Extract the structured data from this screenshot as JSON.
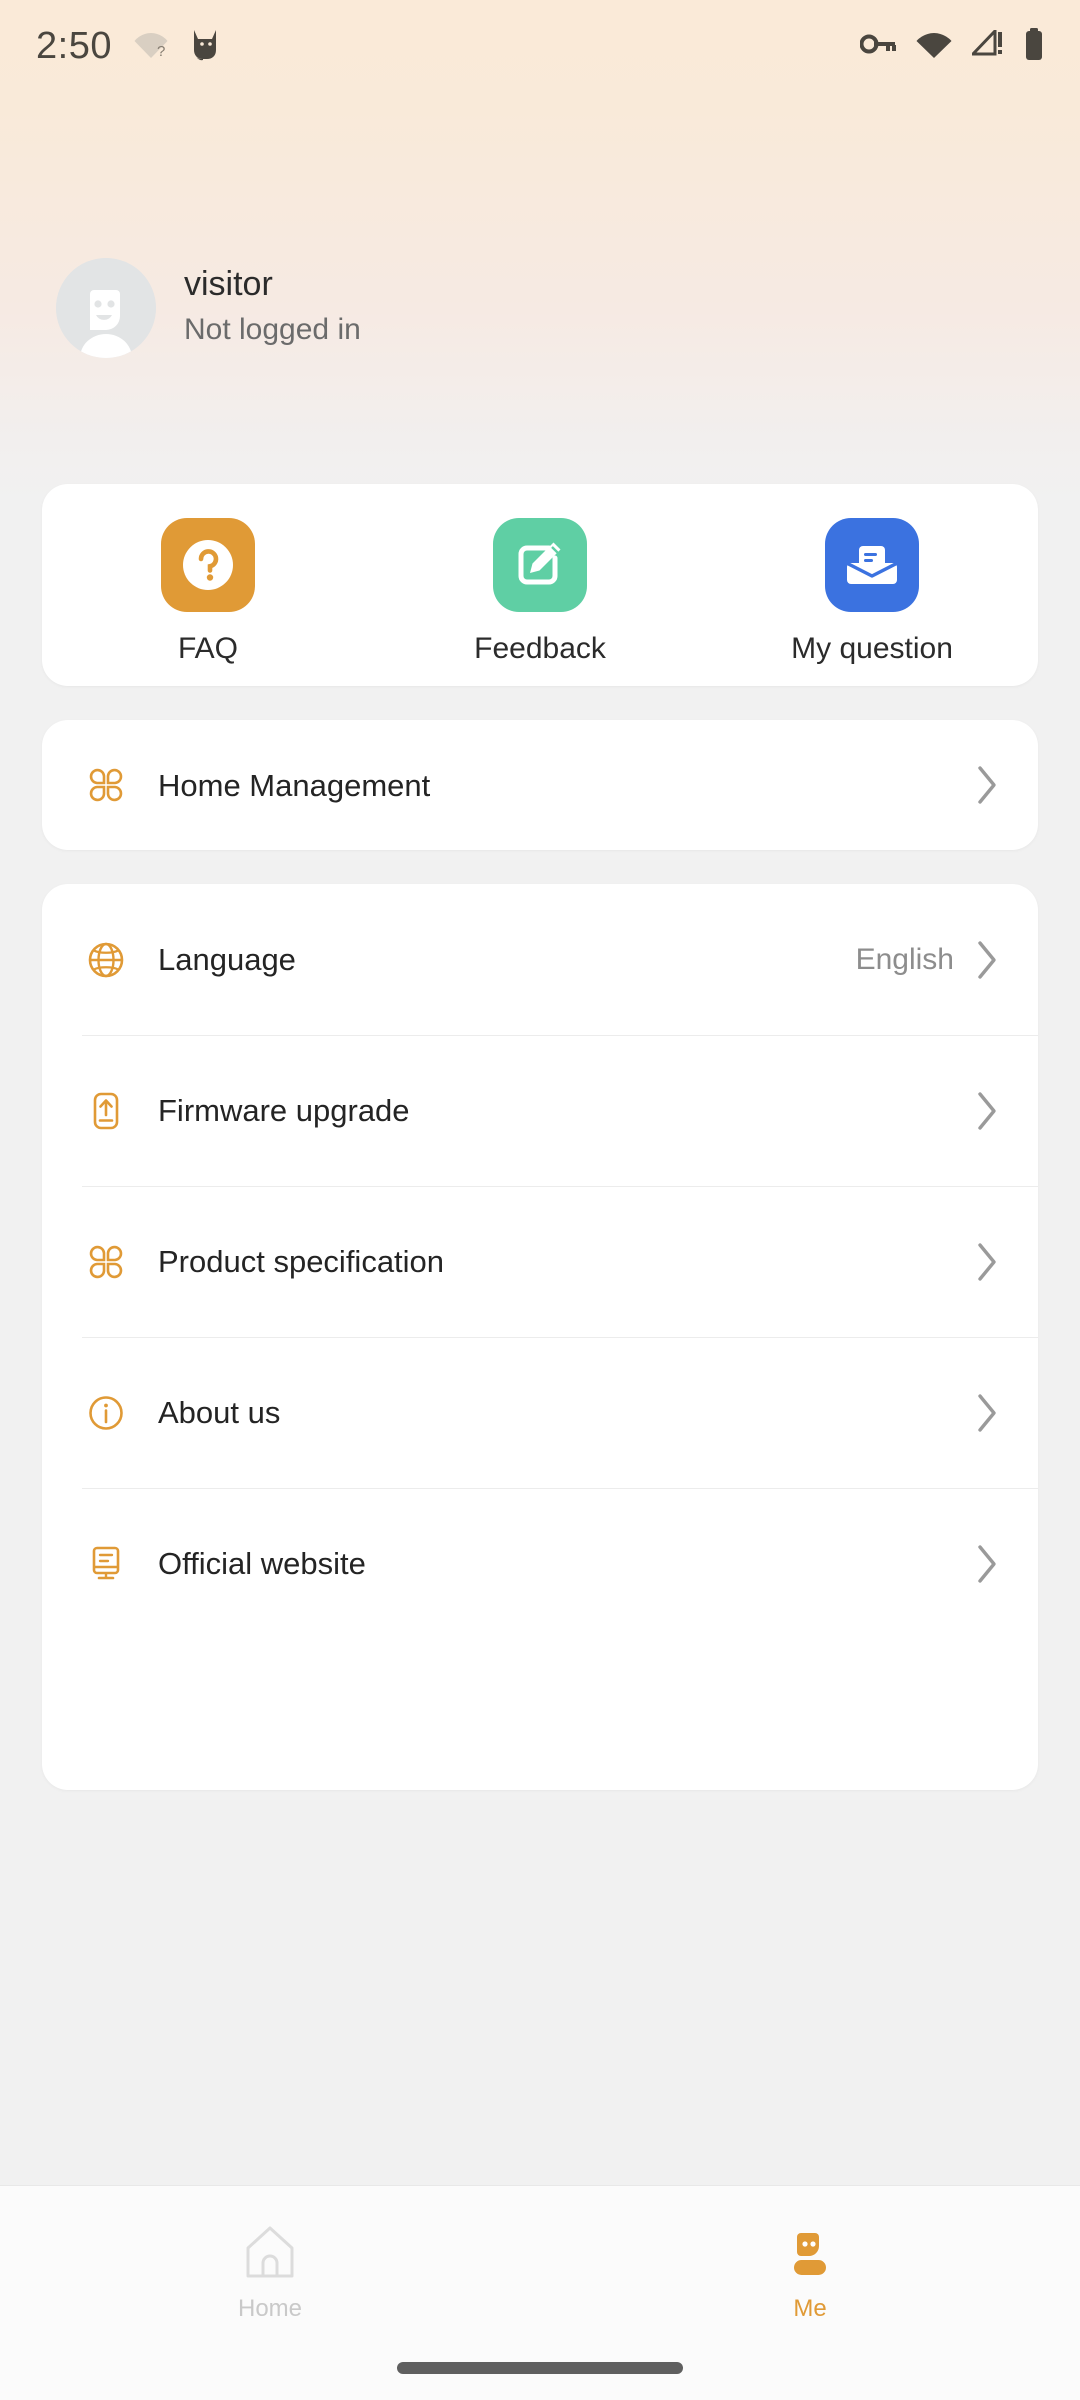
{
  "status_bar": {
    "time": "2:50",
    "left_icons": [
      "wifi-question-icon",
      "cat-app-icon"
    ],
    "right_icons": [
      "vpn-key-icon",
      "wifi-icon",
      "cellular-alert-icon",
      "battery-icon"
    ]
  },
  "profile": {
    "avatar": "person-smiley-avatar",
    "name": "visitor",
    "status": "Not logged in"
  },
  "quick_actions": [
    {
      "label": "FAQ",
      "icon": "question-mark-icon",
      "color": "#e09a36"
    },
    {
      "label": "Feedback",
      "icon": "edit-pencil-icon",
      "color": "#5fcfa4"
    },
    {
      "label": "My question",
      "icon": "mail-envelope-icon",
      "color": "#3b72e0"
    }
  ],
  "home_section": [
    {
      "label": "Home Management",
      "icon": "clover-grid-icon",
      "value": ""
    }
  ],
  "settings_section": [
    {
      "label": "Language",
      "icon": "globe-icon",
      "value": "English"
    },
    {
      "label": "Firmware upgrade",
      "icon": "device-upgrade-icon",
      "value": ""
    },
    {
      "label": "Product specification",
      "icon": "clover-grid-icon",
      "value": ""
    },
    {
      "label": "About us",
      "icon": "info-circle-icon",
      "value": ""
    },
    {
      "label": "Official website",
      "icon": "monitor-icon",
      "value": ""
    }
  ],
  "bottom_nav": [
    {
      "label": "Home",
      "icon": "home-icon",
      "active": false
    },
    {
      "label": "Me",
      "icon": "person-icon",
      "active": true
    }
  ],
  "colors": {
    "accent": "#e09a36",
    "header_bg": "#faead8",
    "page_bg": "#f1f1f1",
    "card_bg": "#ffffff",
    "text_primary": "#242424",
    "text_secondary": "#8d8d8d"
  }
}
